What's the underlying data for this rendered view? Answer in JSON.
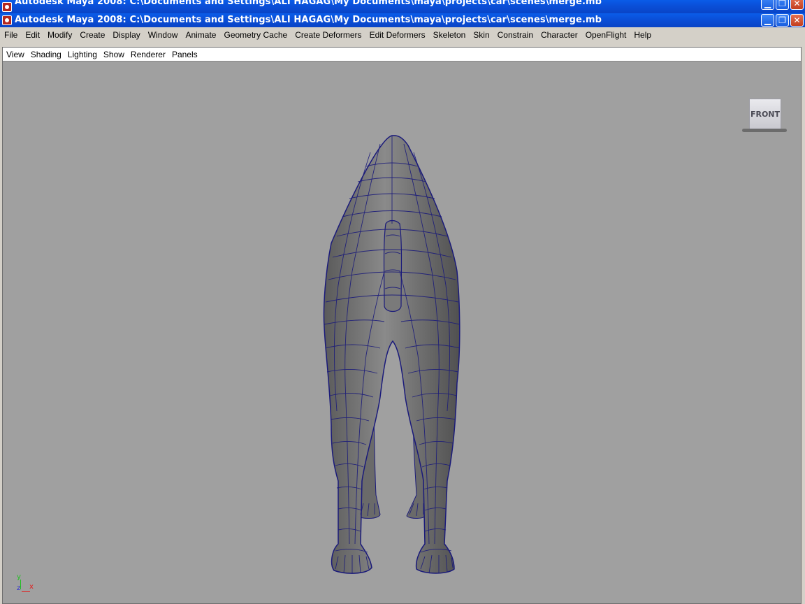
{
  "window": {
    "title_back": "Autodesk Maya 2008: C:\\Documents and Settings\\ALI HAGAG\\My Documents\\maya\\projects\\car\\scenes\\merge.mb",
    "title_front": "Autodesk Maya 2008: C:\\Documents and Settings\\ALI HAGAG\\My Documents\\maya\\projects\\car\\scenes\\merge.mb",
    "icon": "maya-app-icon",
    "controls": {
      "minimize": "▁",
      "restore": "❐",
      "close": "✕"
    }
  },
  "main_menu": [
    "File",
    "Edit",
    "Modify",
    "Create",
    "Display",
    "Window",
    "Animate",
    "Geometry Cache",
    "Create Deformers",
    "Edit Deformers",
    "Skeleton",
    "Skin",
    "Constrain",
    "Character",
    "OpenFlight",
    "Help"
  ],
  "panel_menu": [
    "View",
    "Shading",
    "Lighting",
    "Show",
    "Renderer",
    "Panels"
  ],
  "viewport": {
    "view_cube_label": "FRONT",
    "axis": {
      "x": "x",
      "y": "y",
      "z": "z"
    },
    "background_color": "#a0a0a0",
    "model_color": "#6e6e6e",
    "wire_color": "#1a1a7a"
  }
}
